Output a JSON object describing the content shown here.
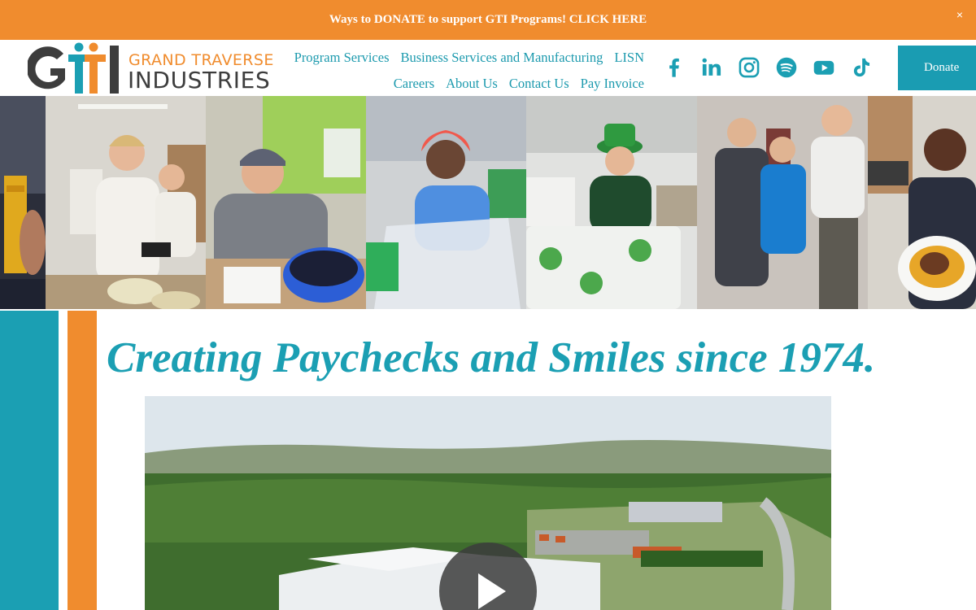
{
  "announcement": {
    "text": "Ways to DONATE to support GTI Programs! CLICK HERE",
    "close_label": "×"
  },
  "logo": {
    "line1": "GRAND TRAVERSE",
    "line2": "INDUSTRIES"
  },
  "nav": {
    "row1": [
      "Program Services",
      "Business Services and Manufacturing",
      "LISN"
    ],
    "row2": [
      "Careers",
      "About Us",
      "Contact Us",
      "Pay Invoice"
    ]
  },
  "socials": [
    "facebook-icon",
    "linkedin-icon",
    "instagram-icon",
    "spotify-icon",
    "youtube-icon",
    "tiktok-icon"
  ],
  "donate_label": "Donate",
  "hero": {
    "headline": "Creating Paychecks and Smiles since 1974."
  },
  "colors": {
    "orange": "#f08c2e",
    "teal": "#1b9fb3",
    "dark": "#3d3d3d"
  }
}
